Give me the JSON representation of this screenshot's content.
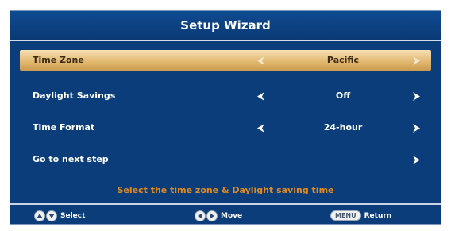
{
  "window": {
    "title": "Setup Wizard"
  },
  "rows": [
    {
      "label": "Time Zone",
      "value": "Pacific",
      "left_arrow": "left-arrow-icon",
      "right_arrow": "right-arrow-icon",
      "selected": true
    },
    {
      "label": "Daylight Savings",
      "value": "Off",
      "left_arrow": "left-arrow-icon",
      "right_arrow": "right-arrow-icon",
      "selected": false
    },
    {
      "label": "Time Format",
      "value": "24-hour",
      "left_arrow": "left-arrow-icon",
      "right_arrow": "right-arrow-icon",
      "selected": false
    },
    {
      "label": "Go to next step",
      "value": "",
      "right_arrow": "right-arrow-icon",
      "selected": false
    }
  ],
  "hint": "Select the time zone & Daylight saving time",
  "footer": {
    "select": {
      "label": "Select",
      "icons": [
        "up-button-icon",
        "down-button-icon"
      ]
    },
    "move": {
      "label": "Move",
      "icons": [
        "left-button-icon",
        "right-button-icon"
      ]
    },
    "return": {
      "label": "Return",
      "key": "MENU"
    }
  },
  "colors": {
    "background": "#0b3d7a",
    "selected_row": "#e2b971",
    "hint_text": "#e38a1c",
    "text": "#ffffff"
  }
}
